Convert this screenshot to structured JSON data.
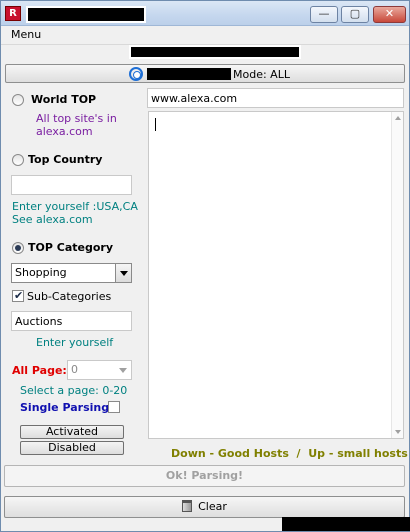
{
  "window": {
    "icon_letter": "R"
  },
  "menu": {
    "label": "Menu"
  },
  "modebar": {
    "label": "Mode: ALL"
  },
  "world_top": {
    "label": "World TOP",
    "desc_line1": "All top site's in",
    "desc_line2": "alexa.com"
  },
  "top_country": {
    "label": "Top Country",
    "value": "",
    "hint_line1": "Enter yourself :USA,CA",
    "hint_line2": "See alexa.com"
  },
  "top_category": {
    "label": "TOP Category",
    "selected": "Shopping",
    "subcat_label": "Sub-Categories",
    "subcat_value": "Auctions",
    "hint": "Enter yourself"
  },
  "pages": {
    "label": "All Page:",
    "value": "0",
    "hint": "Select a page: 0-20"
  },
  "single_parsing": {
    "label": "Single Parsing:"
  },
  "buttons": {
    "activated": "Activated",
    "disabled": "Disabled",
    "parse": "Ok! Parsing!",
    "clear": "Clear"
  },
  "url_field": {
    "value": "www.alexa.com"
  },
  "hosts_legend": "Down - Good Hosts  /  Up - small hosts",
  "colors": {
    "purple": "#7a1ea1",
    "teal": "#008080",
    "red": "#e00000",
    "blue": "#1010b0",
    "olive": "#808000"
  }
}
